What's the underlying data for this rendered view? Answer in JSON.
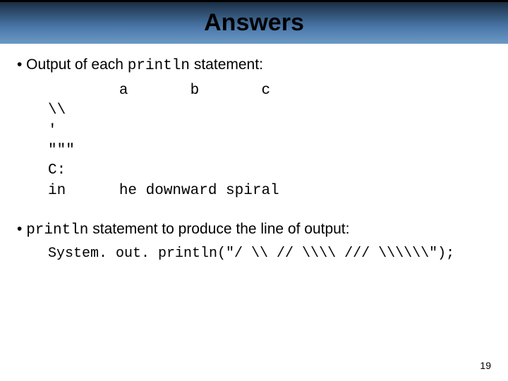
{
  "header": {
    "title": "Answers"
  },
  "bullet1": {
    "prefix": "• Output of each ",
    "code": "println",
    "suffix": " statement:"
  },
  "output": "        a       b       c\n\\\\\n'\n\"\"\"\nC:\nin      he downward spiral",
  "bullet2": {
    "prefix": "• ",
    "code": "println",
    "suffix": " statement to produce the line of output:"
  },
  "codeLine": "System. out. println(\"/ \\\\ // \\\\\\\\ /// \\\\\\\\\\\\\");",
  "pageNumber": "19"
}
